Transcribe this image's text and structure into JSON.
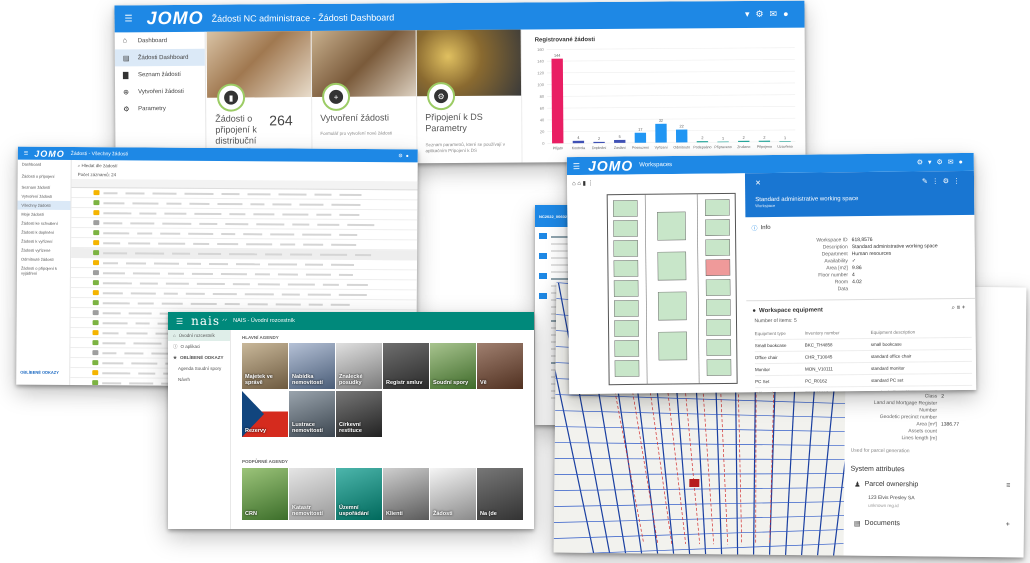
{
  "dashboard": {
    "logo": "JOMO",
    "title": "Žádosti NC administrace - Žádosti Dashboard",
    "sidebar": [
      "Dashboard",
      "Žádosti Dashboard",
      "Seznam žádostí",
      "Vytvoření žádosti",
      "Parametry"
    ],
    "cards": [
      {
        "title": "Žádosti o připojení k distribuční soustavě",
        "count": "264",
        "icon": "document-icon"
      },
      {
        "title": "Vytvoření žádosti",
        "subtitle": "Formulář pro vytvoření nové žádosti",
        "icon": "plus-icon"
      },
      {
        "title": "Připojení k DS Parametry",
        "subtitle": "Seznam parametrů, které se používají v aplikačním Připojení k DS",
        "icon": "gears-icon"
      }
    ],
    "chart_title": "Registrované žádosti"
  },
  "chart_data": {
    "type": "bar",
    "title": "Registrované žádosti",
    "categories": [
      "Přijato",
      "Kontrola",
      "Doplnění",
      "Zaslání",
      "Posouzení",
      "Vyřízení",
      "Odmítnuto",
      "Podepsáno",
      "Připraveno",
      "Zrušeno",
      "Připojeno",
      "Uzavřeno"
    ],
    "values": [
      144,
      4,
      2,
      5,
      17,
      32,
      22,
      2,
      1,
      2,
      2,
      1
    ],
    "colors": [
      "#e91e63",
      "#3f51b5",
      "#3f51b5",
      "#3f51b5",
      "#2196f3",
      "#2196f3",
      "#2196f3",
      "#26a69a",
      "#26a69a",
      "#26a69a",
      "#26a69a",
      "#26a69a"
    ],
    "ylim": [
      0,
      160
    ],
    "yticks": [
      0,
      20,
      40,
      60,
      80,
      100,
      120,
      140,
      160
    ]
  },
  "table": {
    "logo": "JOMO",
    "title": "Žádosti - Všechny žádosti",
    "sidebar": [
      "Dashboard",
      "Žádosti o připojení",
      "Seznam žádostí",
      "Vytvoření žádosti",
      "Všechny žádosti",
      "Moje žádosti",
      "Žádosti ke schválení",
      "Žádosti k doplnění",
      "Žádosti k vyřízení",
      "Žádosti vyřízené",
      "Odmítnuté žádosti",
      "Žádosti o připojení k vyjádření"
    ],
    "footer": "OBLÍBENÉ ODKAZY",
    "count_label": "Počet záznamů: 24",
    "search_label": "Hledat dle žádostí"
  },
  "form": {
    "title": "NC2022_00602 - Zásobování"
  },
  "workspace": {
    "logo": "JOMO",
    "title": "Workspaces",
    "detail_title": "Standard administrative working space",
    "detail_subtitle": "Workspace",
    "info_label": "Info",
    "fields": [
      [
        "Workspace ID",
        "618,8576"
      ],
      [
        "Description",
        "Standard administrative working space"
      ],
      [
        "Department",
        "Human resources"
      ],
      [
        "Availability",
        "✓"
      ],
      [
        "Area [m2]",
        "9.86"
      ],
      [
        "Floor number",
        "4"
      ],
      [
        "Room",
        "4.02"
      ],
      [
        "Data",
        ""
      ]
    ],
    "equipment_label": "Workspace equipment",
    "equipment_count": "Number of items: 5",
    "equipment_headers": [
      "Equipment type",
      "Inventory number",
      "Equipment description"
    ],
    "equipment_rows": [
      [
        "Small bookcase",
        "BKC_TH4858",
        "small bookcase"
      ],
      [
        "Office chair",
        "CHR_T10045",
        "standard office chair"
      ],
      [
        "Monitor",
        "MON_V10111",
        "standard monitor"
      ],
      [
        "PC Set",
        "PC_R0162",
        "standard PC set"
      ],
      [
        "Office table",
        "TBL_01909",
        "standard office table"
      ]
    ]
  },
  "map": {
    "fields": [
      [
        "Parcel kind",
        ""
      ],
      [
        "Class",
        "2"
      ],
      [
        "Land and Mortgage Register",
        ""
      ],
      [
        "Number",
        ""
      ],
      [
        "Geodetic precinct number",
        ""
      ],
      [
        "Area [m²]",
        "1386.77"
      ],
      [
        "Assets count",
        ""
      ],
      [
        "Lines length [m]",
        ""
      ]
    ],
    "used_for": "Used for parcel generation",
    "system_attrs": "System attributes",
    "ownership": "Parcel ownership",
    "owner": "123 Elvis Presley SA",
    "owner_sub": "unknown reg.id",
    "documents": "Documents"
  },
  "nais": {
    "logo": "nais",
    "title": "NAIS - Úvodní rozcestník",
    "sidebar": [
      "Úvodní rozcestník",
      "O aplikaci",
      "OBLÍBENÉ ODKAZY",
      "Agenda Soudní spory",
      "Návrh"
    ],
    "section_main": "HLAVNÍ AGENDY",
    "section_support": "PODPŮRNÉ AGENDY",
    "main_tiles": [
      "Majetek ve správě",
      "Nabídka nemovitostí",
      "Znalecké posudky",
      "Registr smluv",
      "Soudní spory",
      "Vě",
      "Rezervy",
      "Lustrace nemovitostí",
      "Církevní restituce"
    ],
    "support_tiles": [
      "CRN",
      "Katastr nemovitostí",
      "Územní uspořádání",
      "Klienti",
      "Žádosti",
      "Na (de"
    ]
  }
}
